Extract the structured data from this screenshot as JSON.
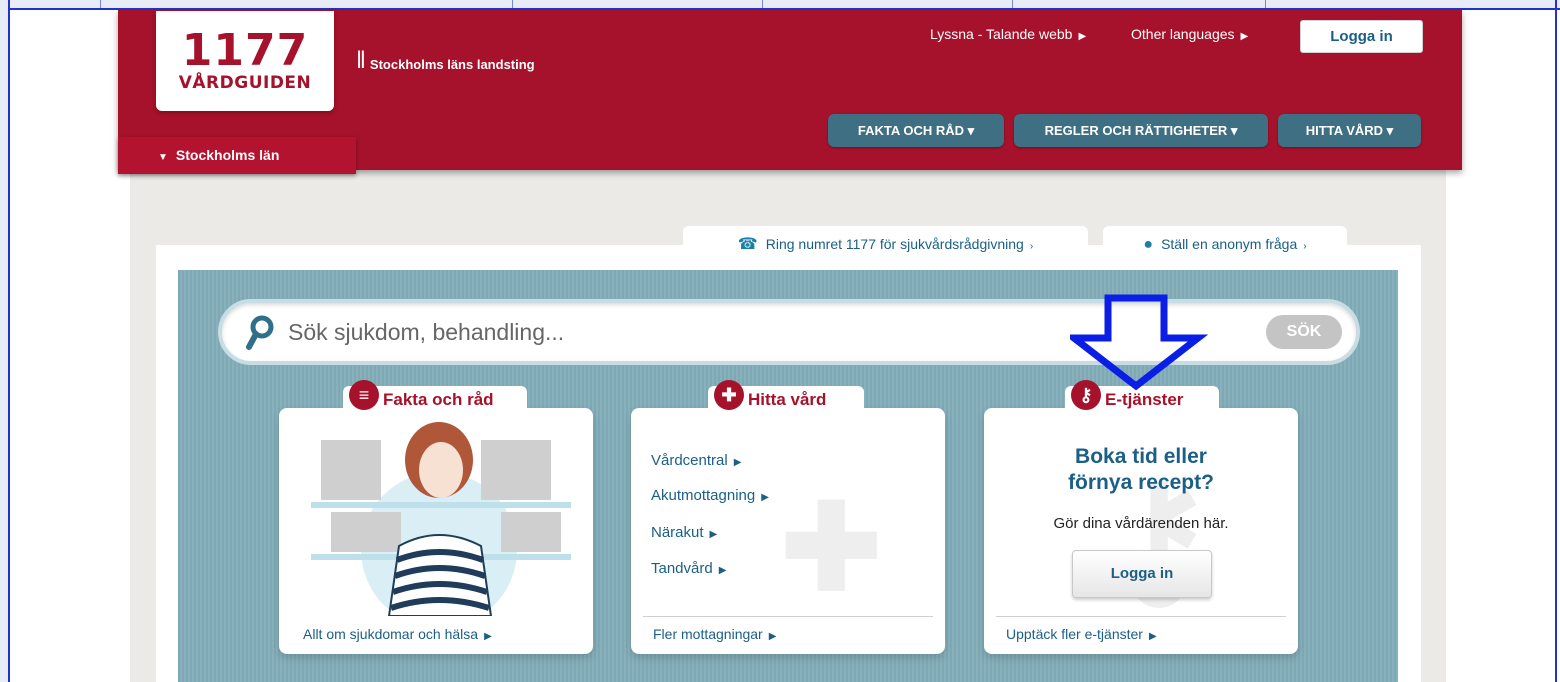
{
  "header": {
    "logo_number": "1177",
    "logo_word": "VÅRDGUIDEN",
    "landsting": "Stockholms läns landsting",
    "listen_link": "Lyssna - Talande webb",
    "languages_link": "Other languages",
    "login_label": "Logga in"
  },
  "nav": {
    "items": [
      {
        "label": "FAKTA OCH RÅD ▾"
      },
      {
        "label": "REGLER OCH RÄTTIGHETER ▾"
      },
      {
        "label": "HITTA VÅRD ▾"
      }
    ],
    "region": "Stockholms län"
  },
  "tabs": {
    "call": "Ring numret 1177 för sjukvårdsrådgivning",
    "ask": "Ställ en anonym fråga"
  },
  "search": {
    "placeholder": "Sök sjukdom, behandling...",
    "button": "SÖK"
  },
  "cards": {
    "fakta": {
      "title": "Fakta och råd",
      "link": "Allt om sjukdomar och hälsa"
    },
    "hitta": {
      "title": "Hitta vård",
      "items": [
        "Vårdcentral",
        "Akutmottagning",
        "Närakut",
        "Tandvård"
      ],
      "link": "Fler mottagningar"
    },
    "etjanster": {
      "title": "E-tjänster",
      "heading_line1": "Boka tid eller",
      "heading_line2": "förnya recept?",
      "subtitle": "Gör dina vårdärenden här.",
      "button": "Logga in",
      "link": "Upptäck fler e-tjänster"
    }
  },
  "colors": {
    "brand_red": "#a6112b",
    "nav_teal": "#3f6f82",
    "link_blue": "#1b5f86",
    "annotation_arrow": "#0a1ee6"
  },
  "icons": [
    "phone-icon",
    "chat-bubble-icon",
    "search-icon",
    "book-icon",
    "cross-icon",
    "key-icon",
    "down-arrow-annotation-icon"
  ]
}
